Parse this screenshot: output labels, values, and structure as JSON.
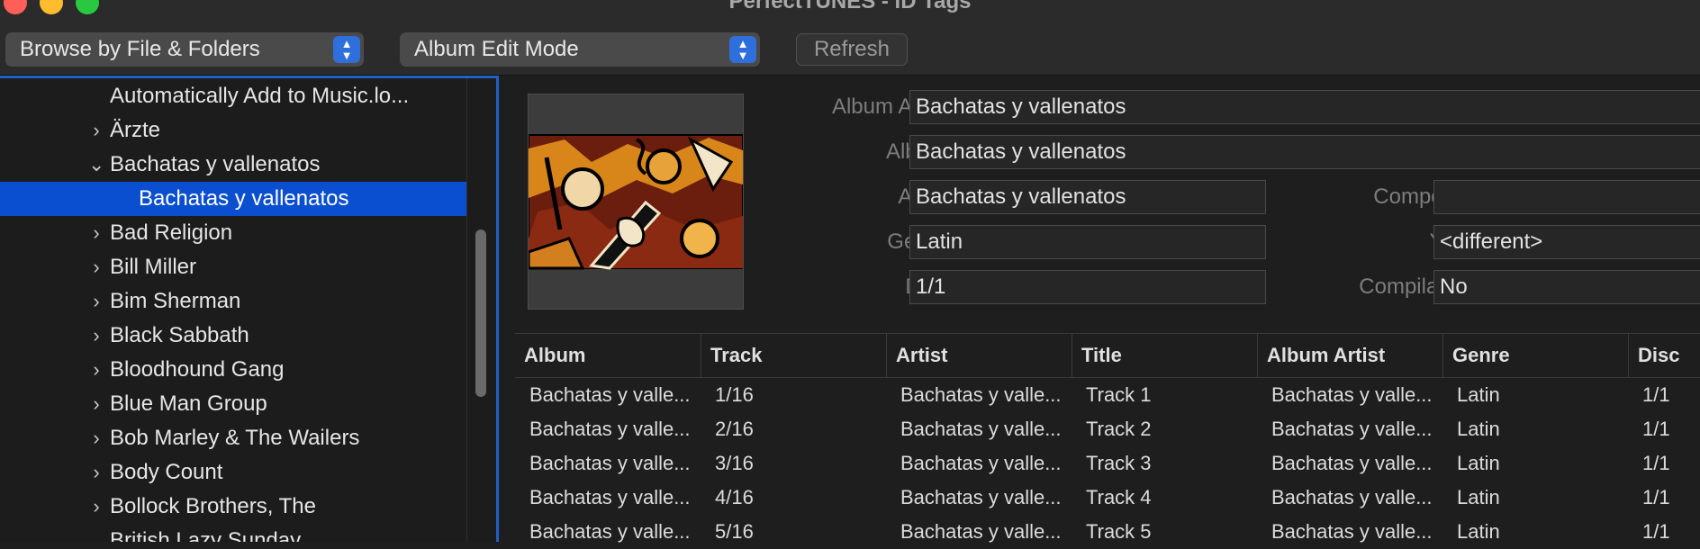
{
  "window": {
    "title": "PerfectTUNES - ID Tags"
  },
  "toolbar": {
    "browse_mode": "Browse by File & Folders",
    "edit_mode": "Album Edit Mode",
    "refresh_label": "Refresh"
  },
  "sidebar": {
    "items": [
      {
        "label": "Automatically Add to Music.lo...",
        "disclosure": ""
      },
      {
        "label": "Ärzte",
        "disclosure": "›"
      },
      {
        "label": "Bachatas y vallenatos",
        "disclosure": "⌄"
      },
      {
        "label": "Bachatas y vallenatos",
        "disclosure": "",
        "selected": true
      },
      {
        "label": "Bad Religion",
        "disclosure": "›"
      },
      {
        "label": "Bill Miller",
        "disclosure": "›"
      },
      {
        "label": "Bim Sherman",
        "disclosure": "›"
      },
      {
        "label": "Black Sabbath",
        "disclosure": "›"
      },
      {
        "label": "Bloodhound Gang",
        "disclosure": "›"
      },
      {
        "label": "Blue Man Group",
        "disclosure": "›"
      },
      {
        "label": "Bob Marley & The Wailers",
        "disclosure": "›"
      },
      {
        "label": "Body Count",
        "disclosure": "›"
      },
      {
        "label": "Bollock Brothers, The",
        "disclosure": "›"
      },
      {
        "label": "British Lazy Sunday",
        "disclosure": ""
      }
    ]
  },
  "fields": {
    "album_artist": {
      "label": "Album Artist",
      "value": "Bachatas y vallenatos"
    },
    "album": {
      "label": "Album",
      "value": "Bachatas y vallenatos"
    },
    "artist": {
      "label": "Artist",
      "value": "Bachatas y vallenatos"
    },
    "composer": {
      "label": "Composer",
      "value": ""
    },
    "genre": {
      "label": "Genre",
      "value": "Latin"
    },
    "year": {
      "label": "Year",
      "value": "<different>"
    },
    "disc": {
      "label": "Disc",
      "value": "1/1"
    },
    "compilation": {
      "label": "Compilation",
      "value": "No"
    }
  },
  "table": {
    "columns": [
      "Album",
      "Track",
      "Artist",
      "Title",
      "Album Artist",
      "Genre",
      "Disc"
    ],
    "rows": [
      [
        "Bachatas y valle...",
        "1/16",
        "Bachatas y valle...",
        "Track 1",
        "Bachatas y valle...",
        "Latin",
        "1/1"
      ],
      [
        "Bachatas y valle...",
        "2/16",
        "Bachatas y valle...",
        "Track 2",
        "Bachatas y valle...",
        "Latin",
        "1/1"
      ],
      [
        "Bachatas y valle...",
        "3/16",
        "Bachatas y valle...",
        "Track 3",
        "Bachatas y valle...",
        "Latin",
        "1/1"
      ],
      [
        "Bachatas y valle...",
        "4/16",
        "Bachatas y valle...",
        "Track 4",
        "Bachatas y valle...",
        "Latin",
        "1/1"
      ],
      [
        "Bachatas y valle...",
        "5/16",
        "Bachatas y valle...",
        "Track 5",
        "Bachatas y valle...",
        "Latin",
        "1/1"
      ]
    ]
  },
  "colors": {
    "selection": "#0a4fcf",
    "focus_ring": "#2160c4",
    "popup_accent": "#2f6fdc"
  }
}
